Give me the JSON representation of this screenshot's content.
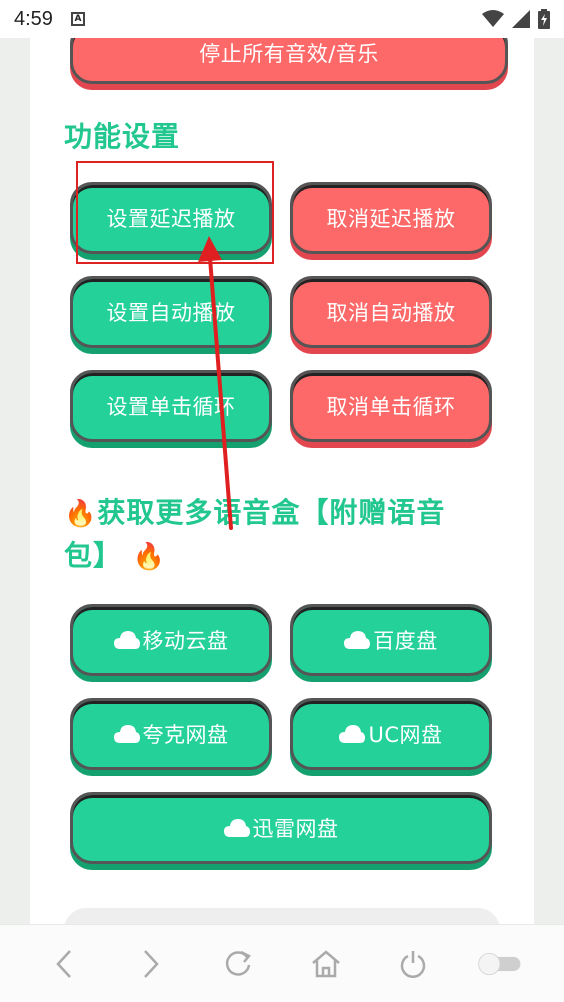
{
  "status_bar": {
    "time": "4:59",
    "notification_icon": "A"
  },
  "top_button": {
    "label": "停止所有音效/音乐"
  },
  "feature_section": {
    "title": "功能设置",
    "buttons": [
      {
        "label": "设置延迟播放",
        "color": "#23d199"
      },
      {
        "label": "取消延迟播放",
        "color": "#fd6868"
      },
      {
        "label": "设置自动播放",
        "color": "#23d199"
      },
      {
        "label": "取消自动播放",
        "color": "#fd6868"
      },
      {
        "label": "设置单击循环",
        "color": "#23d199"
      },
      {
        "label": "取消单击循环",
        "color": "#fd6868"
      }
    ]
  },
  "more_section": {
    "title_line1": "获取更多语音盒【附赠语音",
    "title_line2": "包】",
    "fire_icon": "🔥",
    "buttons": [
      {
        "label": "移动云盘",
        "icon": "cloud-icon"
      },
      {
        "label": "百度盘",
        "icon": "cloud-icon"
      },
      {
        "label": "夸克网盘",
        "icon": "cloud-icon"
      },
      {
        "label": "UC网盘",
        "icon": "cloud-icon"
      },
      {
        "label": "迅雷网盘",
        "icon": "cloud-icon"
      }
    ]
  },
  "colors": {
    "accent_green": "#23d199",
    "accent_red": "#fd6868",
    "heading_green": "#22c78f"
  }
}
